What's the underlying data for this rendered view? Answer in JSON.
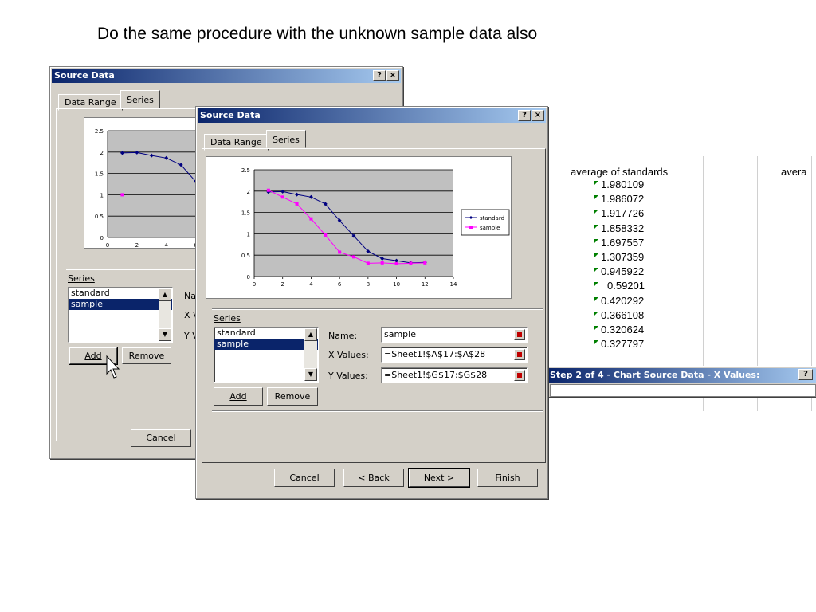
{
  "slide": {
    "caption": "Do the same procedure with the unknown sample data also"
  },
  "back_dialog": {
    "title": "Source Data",
    "help_btn": "?",
    "close_btn": "×",
    "tabs": [
      "Data Range",
      "Series"
    ],
    "series_label": "Series",
    "series_items": [
      "standard",
      "sample"
    ],
    "selected_series": "sample",
    "name_label_partial": "Na",
    "x_label_partial": "X V",
    "y_label_partial": "Y V",
    "add_button": "Add",
    "remove_button": "Remove",
    "cancel_button": "Cancel",
    "chart": {
      "y_ticks": [
        "2.5",
        "2",
        "1.5",
        "1",
        "0.5",
        "0"
      ],
      "x_ticks": [
        "0",
        "2",
        "4",
        "6"
      ]
    }
  },
  "front_dialog": {
    "title": "Source Data",
    "help_btn": "?",
    "close_btn": "×",
    "tabs": [
      "Data Range",
      "Series"
    ],
    "series_label": "Series",
    "series_items": [
      "standard",
      "sample"
    ],
    "selected_series": "sample",
    "name_label": "Name:",
    "x_values_label": "X Values:",
    "y_values_label": "Y Values:",
    "name_value": "sample",
    "x_values_value": "=Sheet1!$A$17:$A$28",
    "y_values_value": "=Sheet1!$G$17:$G$28",
    "add_button": "Add",
    "remove_button": "Remove",
    "cancel_button": "Cancel",
    "back_button": "< Back",
    "next_button": "Next >",
    "finish_button": "Finish"
  },
  "chart_data": {
    "type": "line",
    "x": [
      1,
      2,
      3,
      4,
      5,
      6,
      7,
      8,
      9,
      10,
      11,
      12
    ],
    "xlim": [
      0,
      14
    ],
    "ylim": [
      0,
      2.5
    ],
    "x_ticks": [
      "0",
      "2",
      "4",
      "6",
      "8",
      "10",
      "12",
      "14"
    ],
    "y_ticks": [
      "2.5",
      "2",
      "1.5",
      "1",
      "0.5",
      "0"
    ],
    "grid": "horizontal",
    "legend_position": "right",
    "series": [
      {
        "name": "standard",
        "color": "#000080",
        "values": [
          1.98,
          1.99,
          1.92,
          1.86,
          1.7,
          1.31,
          0.95,
          0.59,
          0.42,
          0.37,
          0.32,
          0.33
        ]
      },
      {
        "name": "sample",
        "color": "#ff00ff",
        "values": [
          2.02,
          1.86,
          1.7,
          1.35,
          0.97,
          0.57,
          0.46,
          0.31,
          0.32,
          0.3,
          0.31,
          0.32
        ]
      }
    ]
  },
  "spreadsheet": {
    "header_left": "average of standards",
    "header_right_partial": "avera",
    "values": [
      "1.980109",
      "1.986072",
      "1.917726",
      "1.858332",
      "1.697557",
      "1.307359",
      "0.945922",
      "0.59201",
      "0.420292",
      "0.366108",
      "0.320624",
      "0.327797"
    ]
  },
  "step_dialog": {
    "title": "Step 2 of 4 - Chart Source Data - X Values:",
    "help_btn": "?",
    "close_btn": "×"
  }
}
